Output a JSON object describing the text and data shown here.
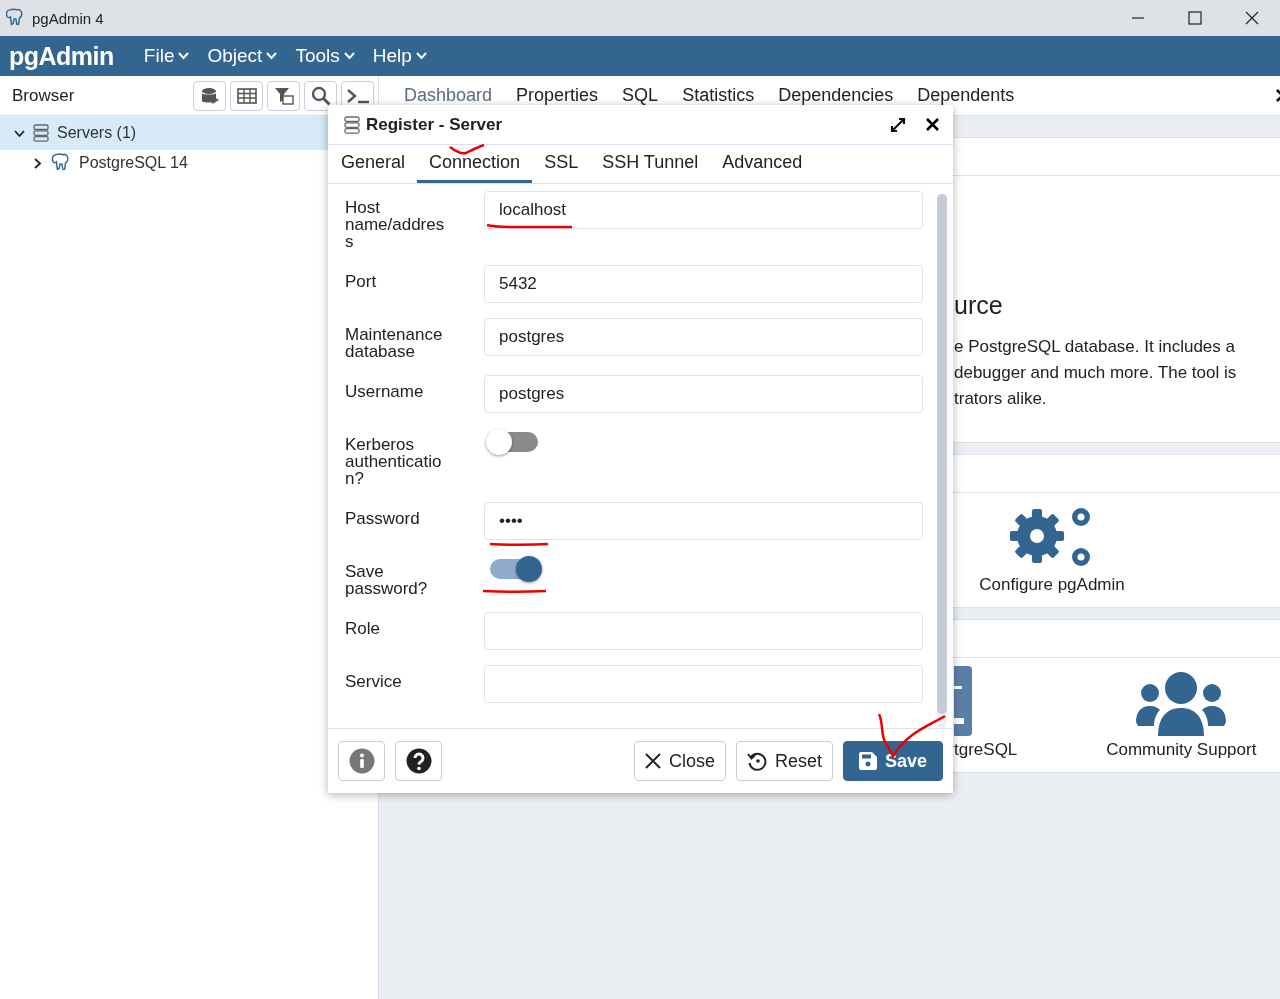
{
  "window": {
    "title": "pgAdmin 4"
  },
  "menu": {
    "logo": "pgAdmin",
    "items": [
      {
        "label": "File"
      },
      {
        "label": "Object"
      },
      {
        "label": "Tools"
      },
      {
        "label": "Help"
      }
    ]
  },
  "browser": {
    "title": "Browser",
    "tree": [
      {
        "label": "Servers (1)",
        "selected": true,
        "expanded": true,
        "children": [
          {
            "label": "PostgreSQL 14",
            "selected": false,
            "expanded": false
          }
        ]
      }
    ]
  },
  "tabs": [
    {
      "label": "Dashboard",
      "selected": true
    },
    {
      "label": "Properties",
      "selected": false
    },
    {
      "label": "SQL",
      "selected": false
    },
    {
      "label": "Statistics",
      "selected": false
    },
    {
      "label": "Dependencies",
      "selected": false
    },
    {
      "label": "Dependents",
      "selected": false
    }
  ],
  "dashboard": {
    "welcome_heading": "urce",
    "welcome_lines": [
      "e PostgreSQL database. It includes a",
      "debugger and much more. The tool is",
      "trators alike."
    ],
    "quick_links": "Configure pgAdmin",
    "partial_link": "tgreSQL",
    "community": "Community Support"
  },
  "dialog": {
    "title": "Register - Server",
    "tabs": [
      {
        "label": "General",
        "selected": false
      },
      {
        "label": "Connection",
        "selected": true
      },
      {
        "label": "SSL",
        "selected": false
      },
      {
        "label": "SSH Tunnel",
        "selected": false
      },
      {
        "label": "Advanced",
        "selected": false
      }
    ],
    "fields": [
      {
        "kind": "text",
        "label": "Host name/address",
        "value": "localhost"
      },
      {
        "kind": "text",
        "label": "Port",
        "value": "5432"
      },
      {
        "kind": "text",
        "label": "Maintenance database",
        "value": "postgres"
      },
      {
        "kind": "text",
        "label": "Username",
        "value": "postgres"
      },
      {
        "kind": "switch",
        "label": "Kerberos authentication?",
        "on": false
      },
      {
        "kind": "text",
        "label": "Password",
        "value": "••••"
      },
      {
        "kind": "switch",
        "label": "Save password?",
        "on": true
      },
      {
        "kind": "text",
        "label": "Role"
      },
      {
        "kind": "text",
        "label": "Service"
      }
    ],
    "buttons": [
      "Close",
      "Reset",
      "Save"
    ]
  }
}
